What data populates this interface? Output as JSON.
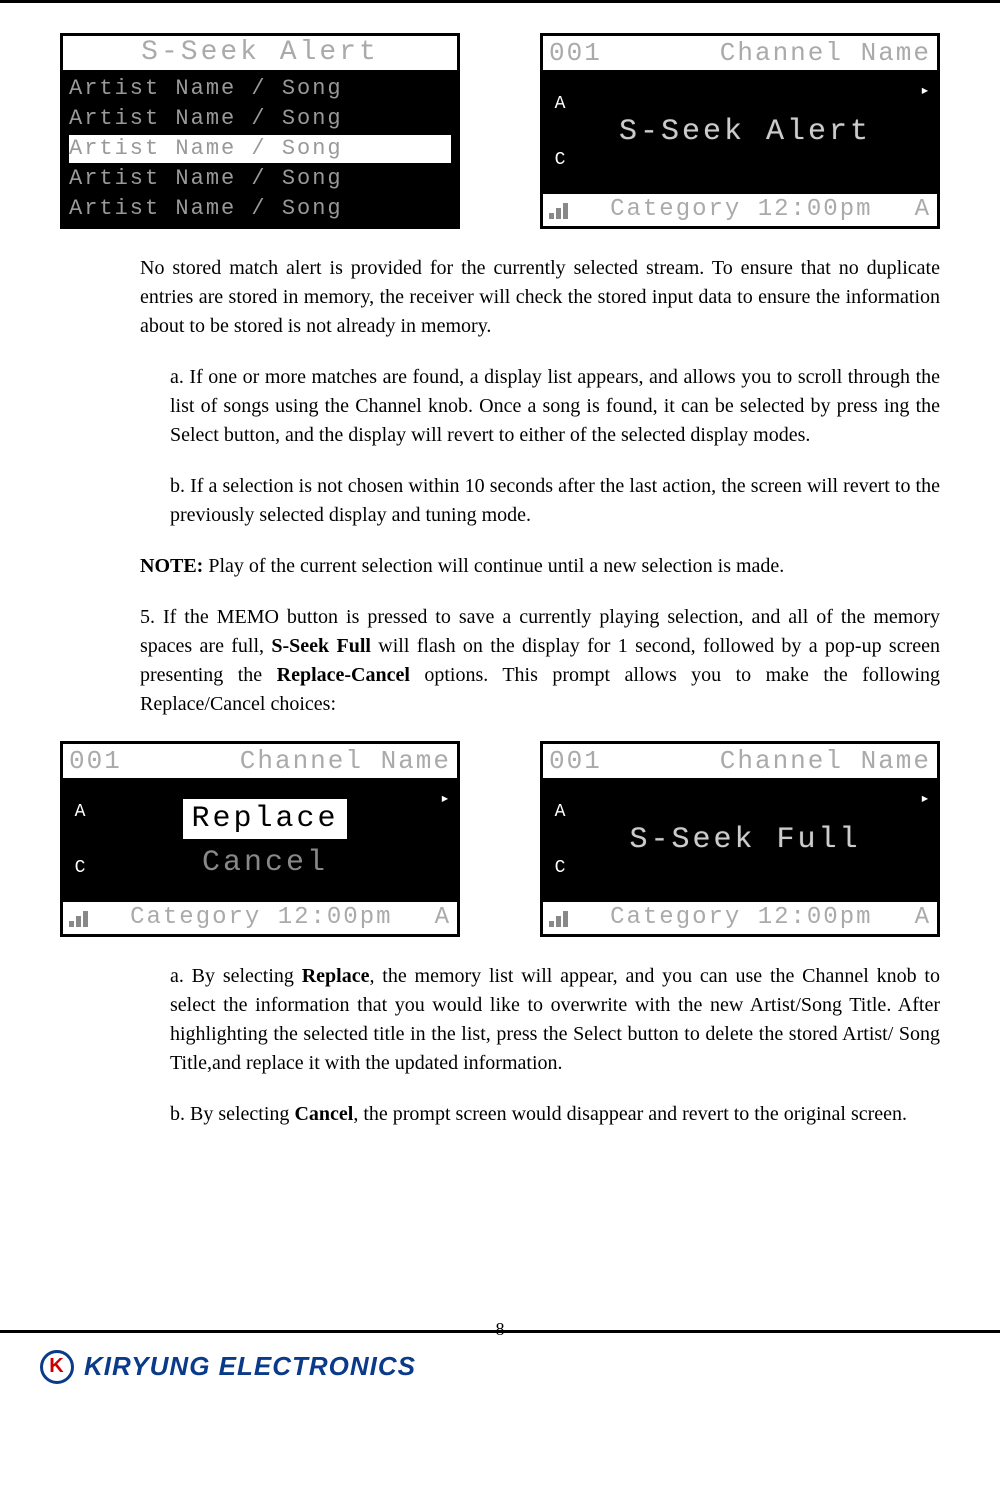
{
  "lcd_list": {
    "title": "S-Seek Alert",
    "rows": [
      "Artist Name / Song",
      "Artist Name / Song",
      "Artist Name / Song",
      "Artist Name / Song",
      "Artist Name / Song"
    ],
    "selected_index": 2
  },
  "lcd_alert": {
    "ch_num": "001",
    "ch_name": "Channel Name",
    "side_top": "A",
    "side_bot": "C",
    "right_sym": "▸",
    "center": "S-Seek Alert",
    "status": "Category 12:00pm",
    "status_r": "A"
  },
  "lcd_replace": {
    "ch_num": "001",
    "ch_name": "Channel Name",
    "side_top": "A",
    "side_bot": "C",
    "right_sym": "▸",
    "opt_sel": "Replace",
    "opt_other": "Cancel",
    "status": "Category 12:00pm",
    "status_r": "A"
  },
  "lcd_full": {
    "ch_num": "001",
    "ch_name": "Channel Name",
    "side_top": "A",
    "side_bot": "C",
    "right_sym": "▸",
    "center": "S-Seek Full",
    "status": "Category 12:00pm",
    "status_r": "A"
  },
  "para1": "No stored match alert is provided for the currently selected stream. To ensure that no duplicate entries are stored in memory, the receiver will check the stored input data to ensure the information about to be stored is not already in memory.",
  "para_a1": "a. If one or more matches are found, a display list appears, and allows you to scroll through the list of songs using the Channel knob. Once a song is found, it can be selected by press ing the Select button, and the display will revert to either of the selected display modes.",
  "para_b1": "b. If a selection is not chosen within 10 seconds after the last action, the screen will revert to the previously selected display and tuning mode.",
  "note_label": "NOTE:",
  "note_text": " Play of the current selection will continue until a new selection is made.",
  "para5_pre": "5. If the MEMO button is pressed to save a currently playing selection, and all of the memory spaces are full, ",
  "para5_bold1": "S-Seek Full",
  "para5_mid": " will flash on the display for 1 second, followed by a pop-up screen presenting the ",
  "para5_bold2": "Replace-Cancel",
  "para5_post": " options. This prompt allows you to make the following Replace/Cancel choices:",
  "para_a2_pre": "a. By selecting ",
  "para_a2_bold": "Replace",
  "para_a2_post": ", the memory list will appear, and you can use the Channel knob to select the information that you would like to overwrite with the new Artist/Song Title. After highlighting the selected title in the list, press the Select button to delete the stored Artist/ Song Title,and replace it with the updated information.",
  "para_b2_pre": "b. By selecting ",
  "para_b2_bold": "Cancel",
  "para_b2_post": ", the prompt screen would disappear and revert to the original screen.",
  "footer_brand": "KIRYUNG",
  "footer_brand2": " ELECTRONICS",
  "page_number": "8"
}
